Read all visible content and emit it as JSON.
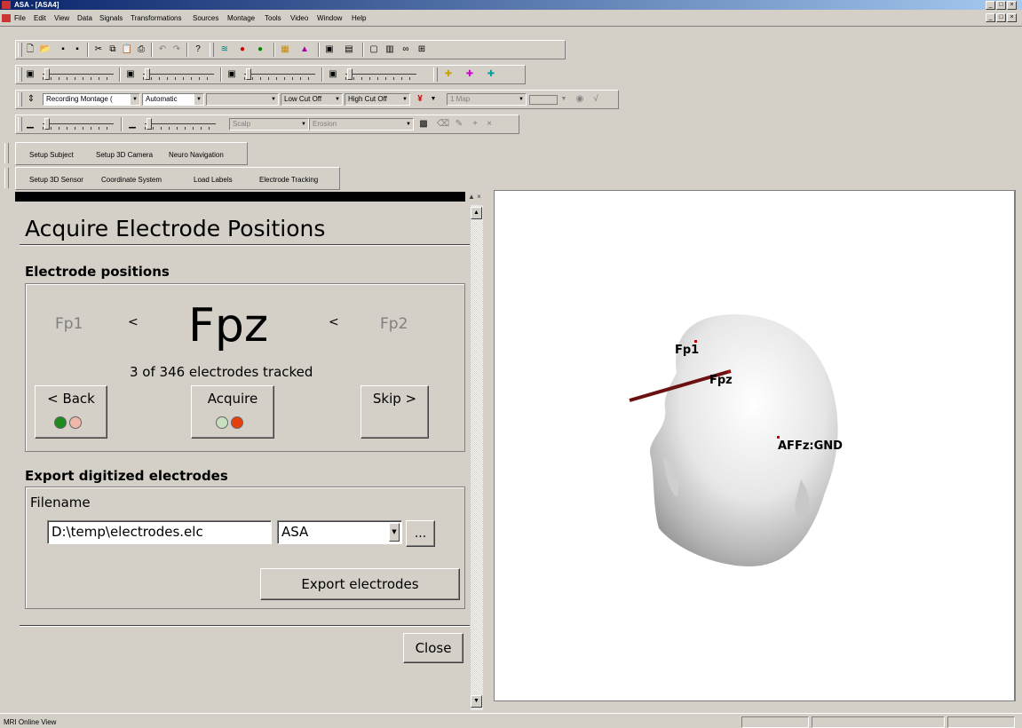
{
  "app": {
    "title": "ASA - [ASA4]",
    "minimize_glyph": "_",
    "restore_glyph": "□",
    "close_glyph": "×"
  },
  "menu": {
    "items": [
      "File",
      "Edit",
      "View",
      "Data",
      "Signals",
      "Transformations",
      "Sources",
      "Montage",
      "Tools",
      "Video",
      "Window",
      "Help"
    ]
  },
  "toolbar3": {
    "montage_combo": "Recording Montage (",
    "scaling_combo": "Automatic",
    "empty_combo": "",
    "low_cut": "Low Cut Off",
    "high_cut": "High Cut Off",
    "map_combo": "1 Map"
  },
  "toolbar4": {
    "scalp_combo": "Scalp",
    "erosion_combo": "Erosion"
  },
  "tabs_row1": [
    "Setup Subject",
    "Setup 3D Camera",
    "Neuro Navigation"
  ],
  "tabs_row2": [
    "Setup 3D Sensor",
    "Coordinate System",
    "Load Labels",
    "Electrode Tracking"
  ],
  "panel": {
    "heading": "Acquire Electrode Positions",
    "section1": "Electrode positions",
    "prev_electrode": "Fp1",
    "current_electrode": "Fpz",
    "next_electrode": "Fp2",
    "arrow_left": "<",
    "arrow_right": "<",
    "tracked_status": "3 of 346 electrodes tracked",
    "back_label": "< Back",
    "acquire_label": "Acquire",
    "skip_label": "Skip >",
    "section2": "Export digitized electrodes",
    "filename_label": "Filename",
    "filename_value": "D:\\temp\\electrodes.elc",
    "format_value": "ASA",
    "browse_label": "...",
    "export_label": "Export electrodes",
    "close_label": "Close",
    "panel_close_glyph": "×"
  },
  "view3d": {
    "labels": [
      "Fp1",
      "Fpz",
      "AFFz:GND"
    ]
  },
  "status": {
    "text": "MRI Online View"
  },
  "colors": {
    "titlebar_start": "#0a246a",
    "titlebar_end": "#a6caf0",
    "light_green": "#1f8a1f",
    "light_red": "#e8400c",
    "electrode_marker": "#cc0000",
    "probe": "#6b1111"
  }
}
